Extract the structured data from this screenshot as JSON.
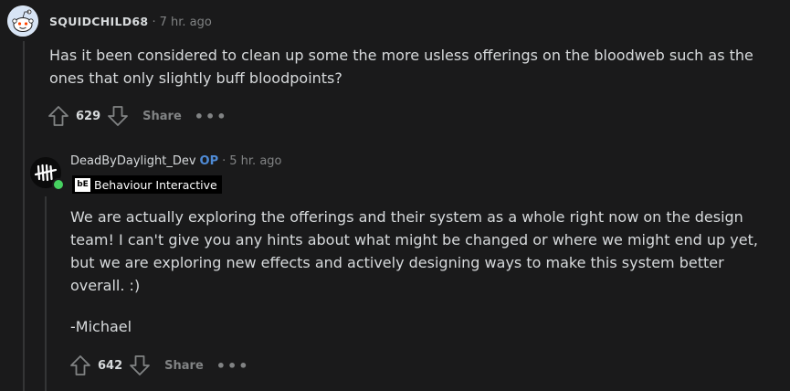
{
  "comment1": {
    "username": "SQUIDCHILD68",
    "separator": "·",
    "time": "7 hr. ago",
    "body": "Has it been considered to clean up some the more usless offerings on the bloodweb such as the ones that only slightly buff bloodpoints?",
    "score": "629",
    "share_label": "Share",
    "more_label": "•••",
    "avatar_icon": "reddit-snoo-avatar"
  },
  "comment2": {
    "username": "DeadByDaylight_Dev",
    "op_label": "OP",
    "separator": "·",
    "time": "5 hr. ago",
    "flair_text": "Behaviour Interactive",
    "body_paragraph": "We are actually exploring the offerings and their system as a whole right now on the design team! I can't give you any hints about what might be changed or where we might end up yet, but we are exploring new effects and actively designing ways to make this system better overall. :)",
    "signature": "-Michael",
    "score": "642",
    "share_label": "Share",
    "more_label": "•••",
    "avatar_icon": "dead-by-daylight-logo",
    "online_status_color": "#46d160"
  },
  "colors": {
    "background": "#1a1a1b",
    "text": "#d7dadc",
    "muted": "#818384",
    "op_accent": "#4f8bd6"
  }
}
